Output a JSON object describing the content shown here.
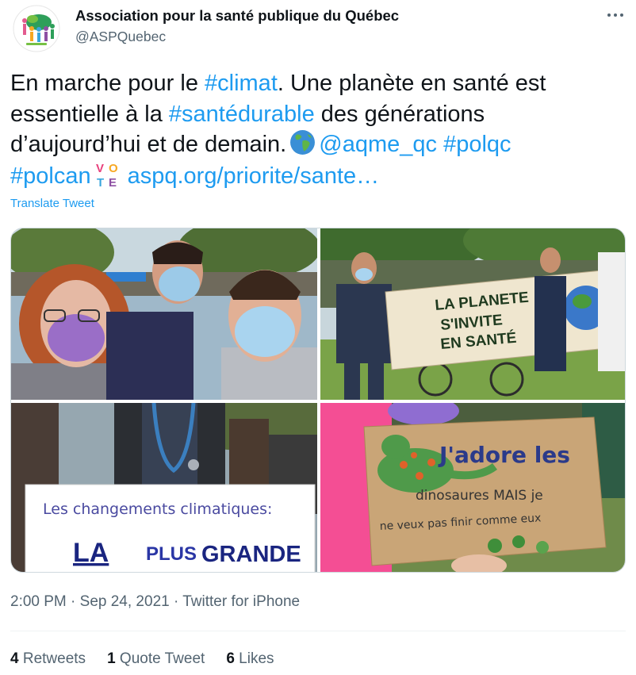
{
  "author": {
    "name": "Association pour la santé publique du Québec",
    "handle": "@ASPQuebec"
  },
  "tweet": {
    "lines": [
      [
        {
          "t": "En marche pour le ",
          "link": false
        },
        {
          "t": "#climat",
          "link": true
        },
        {
          "t": ". Une planète en santé est",
          "link": false
        }
      ],
      [
        {
          "t": "essentielle à la ",
          "link": false
        },
        {
          "t": "#santédurable",
          "link": true
        },
        {
          "t": " des générations",
          "link": false
        }
      ],
      [
        {
          "t": "d’aujourd’hui et de demain.",
          "link": false
        },
        {
          "icon": "earth-icon"
        },
        {
          "t": "@aqme_qc",
          "link": true
        },
        {
          "t": " ",
          "link": false
        },
        {
          "t": "#polqc",
          "link": true
        }
      ],
      [
        {
          "t": "#polcan",
          "link": true
        },
        {
          "icon": "vote-icon"
        },
        {
          "t": "aspq.org/priorite/sante…",
          "link": true
        }
      ]
    ],
    "translate_label": "Translate Tweet"
  },
  "media": {
    "photo2_sign": [
      "LA PLANETE",
      "S'INVITE",
      "EN SANTÉ"
    ],
    "photo3_sign": [
      "Les changements climatiques:",
      "LA",
      "PLUS",
      "GRANDE"
    ],
    "photo4_sign": [
      "J'adore les",
      "dinosaures MAIS je",
      "ne veux pas finir comme eux"
    ]
  },
  "meta": {
    "time": "2:00 PM",
    "date": "Sep 24, 2021",
    "source": "Twitter for iPhone",
    "separator": " · "
  },
  "stats": {
    "retweets_count": "4",
    "retweets_label": "Retweets",
    "quotes_count": "1",
    "quotes_label": "Quote Tweet",
    "likes_count": "6",
    "likes_label": "Likes"
  },
  "colors": {
    "link": "#1d9bf0",
    "secondary_text": "#536471",
    "primary_text": "#0f1419"
  }
}
